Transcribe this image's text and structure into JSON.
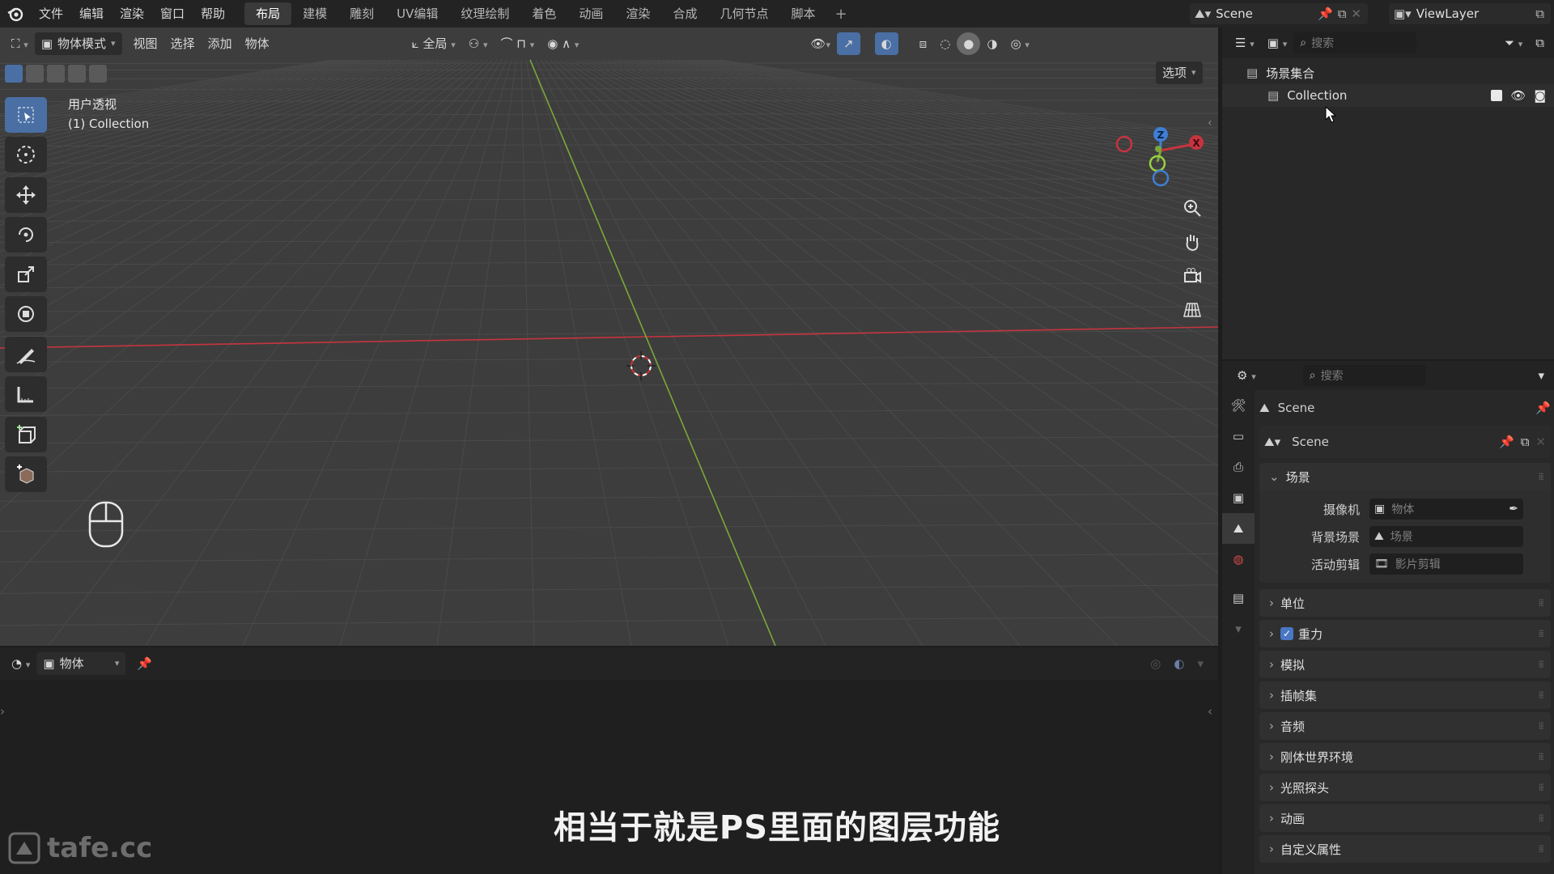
{
  "topbar": {
    "menus": [
      "文件",
      "编辑",
      "渲染",
      "窗口",
      "帮助"
    ],
    "workspace_tabs": [
      "布局",
      "建模",
      "雕刻",
      "UV编辑",
      "纹理绘制",
      "着色",
      "动画",
      "渲染",
      "合成",
      "几何节点",
      "脚本"
    ],
    "active_tab": "布局",
    "add_tab": "+",
    "scene": "Scene",
    "view_layer": "ViewLayer"
  },
  "viewport": {
    "mode": "物体模式",
    "menus": [
      "视图",
      "选择",
      "添加",
      "物体"
    ],
    "transform_orientation": "全局",
    "options": "选项",
    "view_name": "用户透视",
    "collection_label": "(1) Collection",
    "gizmo_axes": [
      "Z",
      "Y",
      "X"
    ]
  },
  "bottom_editor": {
    "mode": "物体"
  },
  "outliner": {
    "search_placeholder": "搜索",
    "root": "场景集合",
    "collection": "Collection"
  },
  "properties": {
    "search_placeholder": "搜索",
    "context": "Scene",
    "scene_selector": "Scene",
    "scene_panel": "场景",
    "fields": [
      {
        "label": "摄像机",
        "placeholder": "物体"
      },
      {
        "label": "背景场景",
        "placeholder": "场景"
      },
      {
        "label": "活动剪辑",
        "placeholder": "影片剪辑"
      }
    ],
    "panels": [
      "单位",
      "重力",
      "模拟",
      "插帧集",
      "音频",
      "刚体世界环境",
      "光照探头",
      "动画",
      "自定义属性"
    ],
    "gravity_checked": true
  },
  "subtitle": "相当于就是PS里面的图层功能",
  "watermark": "tafe.cc",
  "colors": {
    "x_axis": "#c6343f",
    "y_axis": "#7aa83a",
    "z_axis": "#3f7fd3",
    "accent": "#4a77c4"
  }
}
